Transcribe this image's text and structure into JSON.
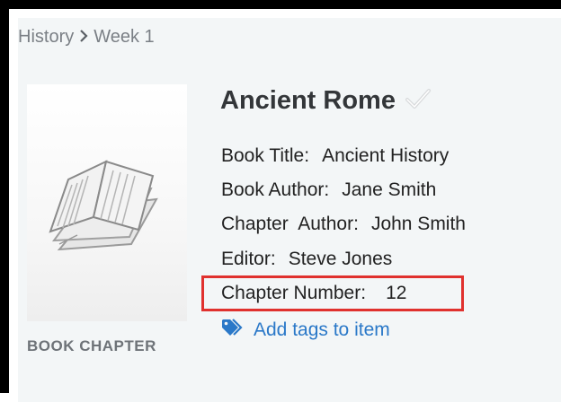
{
  "breadcrumb": {
    "parent": "History",
    "current": "Week 1"
  },
  "item": {
    "title": "Ancient Rome",
    "type_label": "BOOK CHAPTER",
    "fields": {
      "book_title_label": "Book Title:",
      "book_title_value": "Ancient History",
      "book_author_label": "Book Author:",
      "book_author_value": "Jane Smith",
      "chapter_author_label": "Chapter  Author:",
      "chapter_author_value": "John Smith",
      "editor_label": "Editor:",
      "editor_value": "Steve Jones",
      "chapter_number_label": "Chapter Number:",
      "chapter_number_value": "12"
    },
    "add_tags_label": "Add tags to item"
  },
  "icons": {
    "breadcrumb_separator": "chevron-right-icon",
    "title_check": "checkmark-icon",
    "tag": "tag-icon",
    "thumbnail": "open-book-icon"
  },
  "colors": {
    "link": "#2a78c8",
    "highlight_border": "#e0312e",
    "panel_background": "#f3f6f7"
  }
}
